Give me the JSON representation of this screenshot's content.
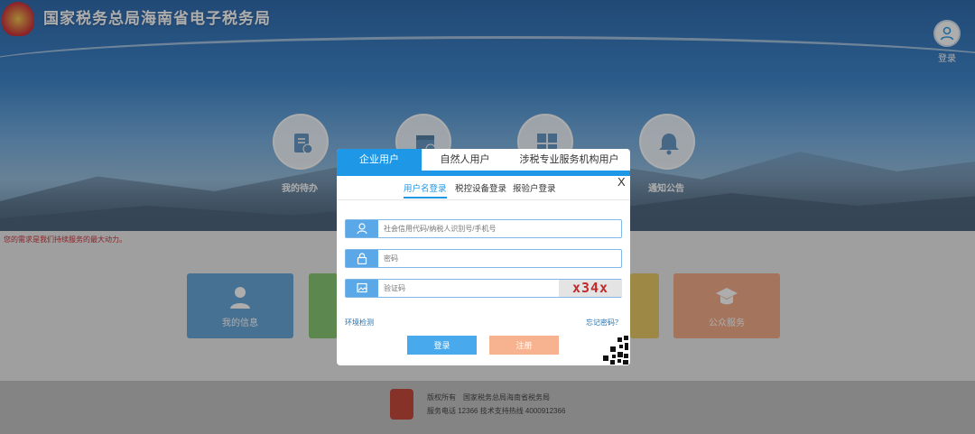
{
  "header": {
    "site_title": "国家税务总局海南省电子税务局",
    "login_label": "登录"
  },
  "quick_icons": [
    {
      "label": "我的待办",
      "icon": "todo-icon"
    },
    {
      "label": "",
      "icon": "calendar-icon"
    },
    {
      "label": "",
      "icon": "grid-icon"
    },
    {
      "label": "通知公告",
      "icon": "bell-icon"
    }
  ],
  "notice_text": "您的需求是我们持续服务的最大动力。",
  "tiles": [
    {
      "label": "我的信息",
      "color": "#5b9fd6",
      "icon": "user-icon"
    },
    {
      "label": "",
      "color": "#7cc46a",
      "icon": ""
    },
    {
      "label": "",
      "color": "#e7c45a",
      "icon": ""
    },
    {
      "label": "公众服务",
      "color": "#f0a37c",
      "icon": "graduation-icon"
    }
  ],
  "footer": {
    "copyright_label": "版权所有",
    "copyright_owner": "国家税务总局海南省税务局",
    "phone_line": "服务电话 12366 技术支持热线 4000912366"
  },
  "login_modal": {
    "tabs": [
      "企业用户",
      "自然人用户",
      "涉税专业服务机构用户"
    ],
    "active_tab": "企业用户",
    "subtabs": [
      "用户名登录",
      "税控设备登录",
      "报验户登录"
    ],
    "active_subtab": "用户名登录",
    "close_label": "X",
    "username_placeholder": "社会信用代码/纳税人识别号/手机号",
    "password_placeholder": "密码",
    "captcha_placeholder": "验证码",
    "captcha_text": "x34x",
    "env_check_link": "环境检测",
    "forgot_password_link": "忘记密码？",
    "login_button": "登录",
    "register_button": "注册"
  },
  "colors": {
    "accent": "#1e97e6",
    "register": "#f7b38f",
    "captcha": "#c62828"
  }
}
